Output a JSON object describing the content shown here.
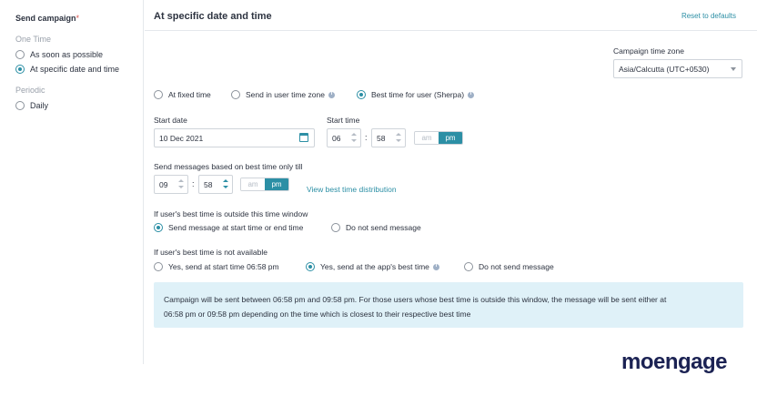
{
  "sidebar": {
    "title": "Send campaign",
    "required_mark": "*",
    "groups": [
      {
        "label": "One Time",
        "options": [
          {
            "label": "As soon as possible",
            "checked": false
          },
          {
            "label": "At specific date and time",
            "checked": true
          }
        ]
      },
      {
        "label": "Periodic",
        "options": [
          {
            "label": "Daily",
            "checked": false
          }
        ]
      }
    ]
  },
  "header": {
    "title": "At specific date and time",
    "reset_label": "Reset to defaults"
  },
  "timezone": {
    "label": "Campaign time zone",
    "value": "Asia/Calcutta (UTC+0530)"
  },
  "send_mode": {
    "options": [
      {
        "label": "At fixed time",
        "checked": false,
        "info": false
      },
      {
        "label": "Send in user time zone",
        "checked": false,
        "info": true
      },
      {
        "label": "Best time for user (Sherpa)",
        "checked": true,
        "info": true
      }
    ]
  },
  "start_date": {
    "label": "Start date",
    "value": "10 Dec 2021"
  },
  "start_time": {
    "label": "Start time",
    "hour": "06",
    "minute": "58",
    "am": "am",
    "pm": "pm",
    "selected": "pm"
  },
  "best_time_till": {
    "label": "Send messages based on best time only till",
    "hour": "09",
    "minute": "58",
    "am": "am",
    "pm": "pm",
    "selected": "pm",
    "link": "View best time distribution"
  },
  "outside_window": {
    "label": "If user's best time is outside this time window",
    "options": [
      {
        "label": "Send message at start time or end time",
        "checked": true
      },
      {
        "label": "Do not send message",
        "checked": false
      }
    ]
  },
  "not_available": {
    "label": "If user's best time is not available",
    "options": [
      {
        "label": "Yes, send at start time 06:58 pm",
        "checked": false,
        "info": false
      },
      {
        "label": "Yes, send at the app's best time",
        "checked": true,
        "info": true
      },
      {
        "label": "Do not send message",
        "checked": false,
        "info": false
      }
    ]
  },
  "notice": {
    "line1": "Campaign will be sent between 06:58 pm and 09:58 pm. For those users whose best time is outside this window, the message will be sent either at",
    "line2": "06:58 pm or 09:58 pm depending on the time which is closest to their respective best time"
  },
  "brand": {
    "logo_text": "moengage"
  },
  "colors": {
    "accent": "#2c8fa5",
    "notice_bg": "#dff1f8",
    "logo": "#1b2253"
  }
}
